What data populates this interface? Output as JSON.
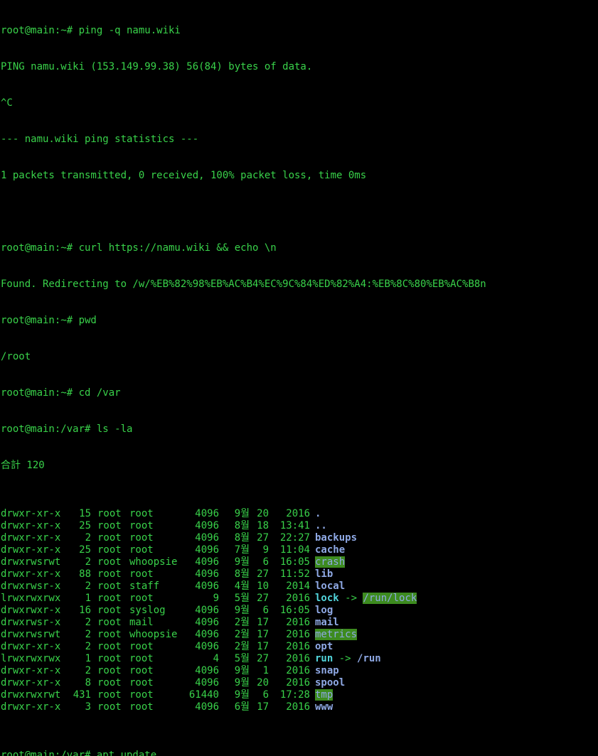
{
  "terminal": {
    "colors": {
      "background": "#000000",
      "text": "#39d24a",
      "directory": "#8fa9e5",
      "symlink": "#52d5dc",
      "sticky_highlight": "#3d8b1f"
    },
    "top_lines": [
      "root@main:~# ping -q namu.wiki",
      "PING namu.wiki (153.149.99.38) 56(84) bytes of data.",
      "^C",
      "--- namu.wiki ping statistics ---",
      "1 packets transmitted, 0 received, 100% packet loss, time 0ms",
      "",
      "root@main:~# curl https://namu.wiki && echo \\n",
      "Found. Redirecting to /w/%EB%82%98%EB%AC%B4%EC%9C%84%ED%82%A4:%EB%8C%80%EB%AC%B8n",
      "root@main:~# pwd",
      "/root",
      "root@main:~# cd /var",
      "root@main:/var# ls -la",
      "合計 120"
    ],
    "listing": [
      {
        "perm": "drwxr-xr-x",
        "links": "15",
        "owner": "root",
        "group": "root",
        "size": "4096",
        "month": "9월",
        "day": "20",
        "time": "2016",
        "name": ".",
        "style": "dir"
      },
      {
        "perm": "drwxr-xr-x",
        "links": "25",
        "owner": "root",
        "group": "root",
        "size": "4096",
        "month": "8월",
        "day": "18",
        "time": "13:41",
        "name": "..",
        "style": "dir"
      },
      {
        "perm": "drwxr-xr-x",
        "links": "2",
        "owner": "root",
        "group": "root",
        "size": "4096",
        "month": "8월",
        "day": "27",
        "time": "22:27",
        "name": "backups",
        "style": "dir"
      },
      {
        "perm": "drwxr-xr-x",
        "links": "25",
        "owner": "root",
        "group": "root",
        "size": "4096",
        "month": "7월",
        "day": "9",
        "time": "11:04",
        "name": "cache",
        "style": "dir"
      },
      {
        "perm": "drwxrwsrwt",
        "links": "2",
        "owner": "root",
        "group": "whoopsie",
        "size": "4096",
        "month": "9월",
        "day": "6",
        "time": "16:05",
        "name": "crash",
        "style": "hl"
      },
      {
        "perm": "drwxr-xr-x",
        "links": "88",
        "owner": "root",
        "group": "root",
        "size": "4096",
        "month": "8월",
        "day": "27",
        "time": "11:52",
        "name": "lib",
        "style": "dir"
      },
      {
        "perm": "drwxrwsr-x",
        "links": "2",
        "owner": "root",
        "group": "staff",
        "size": "4096",
        "month": "4월",
        "day": "10",
        "time": "2014",
        "name": "local",
        "style": "dir"
      },
      {
        "perm": "lrwxrwxrwx",
        "links": "1",
        "owner": "root",
        "group": "root",
        "size": "9",
        "month": "5월",
        "day": "27",
        "time": "2016",
        "name": "lock",
        "style": "link",
        "target": "/run/lock",
        "target_style": "hl"
      },
      {
        "perm": "drwxrwxr-x",
        "links": "16",
        "owner": "root",
        "group": "syslog",
        "size": "4096",
        "month": "9월",
        "day": "6",
        "time": "16:05",
        "name": "log",
        "style": "dir"
      },
      {
        "perm": "drwxrwsr-x",
        "links": "2",
        "owner": "root",
        "group": "mail",
        "size": "4096",
        "month": "2월",
        "day": "17",
        "time": "2016",
        "name": "mail",
        "style": "dir"
      },
      {
        "perm": "drwxrwsrwt",
        "links": "2",
        "owner": "root",
        "group": "whoopsie",
        "size": "4096",
        "month": "2월",
        "day": "17",
        "time": "2016",
        "name": "metrics",
        "style": "hl"
      },
      {
        "perm": "drwxr-xr-x",
        "links": "2",
        "owner": "root",
        "group": "root",
        "size": "4096",
        "month": "2월",
        "day": "17",
        "time": "2016",
        "name": "opt",
        "style": "dir"
      },
      {
        "perm": "lrwxrwxrwx",
        "links": "1",
        "owner": "root",
        "group": "root",
        "size": "4",
        "month": "5월",
        "day": "27",
        "time": "2016",
        "name": "run",
        "style": "link",
        "target": "/run",
        "target_style": "plain"
      },
      {
        "perm": "drwxr-xr-x",
        "links": "2",
        "owner": "root",
        "group": "root",
        "size": "4096",
        "month": "9월",
        "day": "1",
        "time": "2016",
        "name": "snap",
        "style": "dir"
      },
      {
        "perm": "drwxr-xr-x",
        "links": "8",
        "owner": "root",
        "group": "root",
        "size": "4096",
        "month": "9월",
        "day": "20",
        "time": "2016",
        "name": "spool",
        "style": "dir"
      },
      {
        "perm": "drwxrwxrwt",
        "links": "431",
        "owner": "root",
        "group": "root",
        "size": "61440",
        "month": "9월",
        "day": "6",
        "time": "17:28",
        "name": "tmp",
        "style": "hl"
      },
      {
        "perm": "drwxr-xr-x",
        "links": "3",
        "owner": "root",
        "group": "root",
        "size": "4096",
        "month": "6월",
        "day": "17",
        "time": "2016",
        "name": "www",
        "style": "dir"
      }
    ],
    "symlink_arrow": "->",
    "last_line": "root@main:/var# apt update"
  }
}
